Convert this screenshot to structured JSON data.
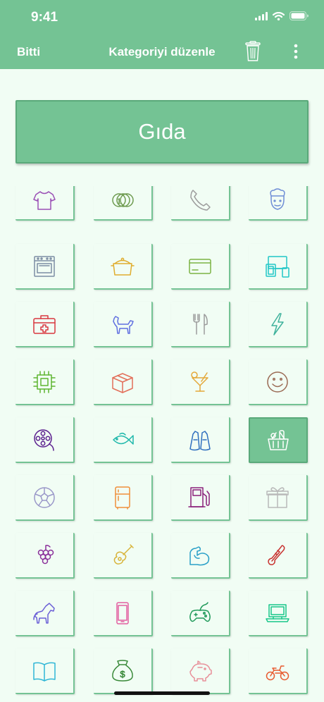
{
  "status": {
    "time": "9:41"
  },
  "nav": {
    "done_label": "Bitti",
    "title": "Kategoriyi düzenle"
  },
  "category": {
    "name": "Gıda"
  },
  "colors": {
    "header": "#74c394",
    "background": "#f1fdf4",
    "selected_tile": "#74c394"
  },
  "icons": [
    {
      "name": "tshirt-icon",
      "color": "#9a4fb5"
    },
    {
      "name": "coins-icon",
      "color": "#6e9b50"
    },
    {
      "name": "phone-icon",
      "color": "#9c9c9c"
    },
    {
      "name": "chef-icon",
      "color": "#6f8ed6"
    },
    {
      "name": "stove-icon",
      "color": "#7c8da3"
    },
    {
      "name": "cooking-pot-icon",
      "color": "#e0ad2f"
    },
    {
      "name": "credit-card-icon",
      "color": "#7cb344"
    },
    {
      "name": "devices-icon",
      "color": "#21c7c7"
    },
    {
      "name": "first-aid-kit-icon",
      "color": "#d9363e"
    },
    {
      "name": "dog-icon",
      "color": "#5f6ee0"
    },
    {
      "name": "fork-knife-icon",
      "color": "#9c9c9c"
    },
    {
      "name": "lightning-icon",
      "color": "#3fb29c"
    },
    {
      "name": "microchip-icon",
      "color": "#5fb531"
    },
    {
      "name": "box-icon",
      "color": "#e36f5a"
    },
    {
      "name": "cocktail-icon",
      "color": "#e4a83a"
    },
    {
      "name": "smiley-icon",
      "color": "#9b6b55"
    },
    {
      "name": "film-reel-icon",
      "color": "#5b1f8f"
    },
    {
      "name": "fish-icon",
      "color": "#1fb8ab"
    },
    {
      "name": "flippers-icon",
      "color": "#2f6fbf"
    },
    {
      "name": "grocery-basket-icon",
      "color": "#ffffff"
    },
    {
      "name": "soccer-ball-icon",
      "color": "#9a98c9"
    },
    {
      "name": "fridge-icon",
      "color": "#ef8f3a"
    },
    {
      "name": "gas-pump-icon",
      "color": "#8a1f7a"
    },
    {
      "name": "gift-icon",
      "color": "#b9b9b9"
    },
    {
      "name": "grapes-icon",
      "color": "#8a2f9a"
    },
    {
      "name": "guitar-icon",
      "color": "#d8b43a"
    },
    {
      "name": "muscle-arm-icon",
      "color": "#2aa0c8"
    },
    {
      "name": "thermometer-icon",
      "color": "#c8322f"
    },
    {
      "name": "horse-icon",
      "color": "#6a5fd6"
    },
    {
      "name": "smartphone-icon",
      "color": "#e35fa0"
    },
    {
      "name": "gamepad-icon",
      "color": "#1f9a5a"
    },
    {
      "name": "laptop-icon",
      "color": "#19c78a"
    },
    {
      "name": "book-icon",
      "color": "#2fb6d6"
    },
    {
      "name": "money-bag-icon",
      "color": "#3a8a3a"
    },
    {
      "name": "piggy-bank-icon",
      "color": "#e8909a"
    },
    {
      "name": "motorcycle-icon",
      "color": "#e85a2f"
    }
  ],
  "selected_index": 19
}
